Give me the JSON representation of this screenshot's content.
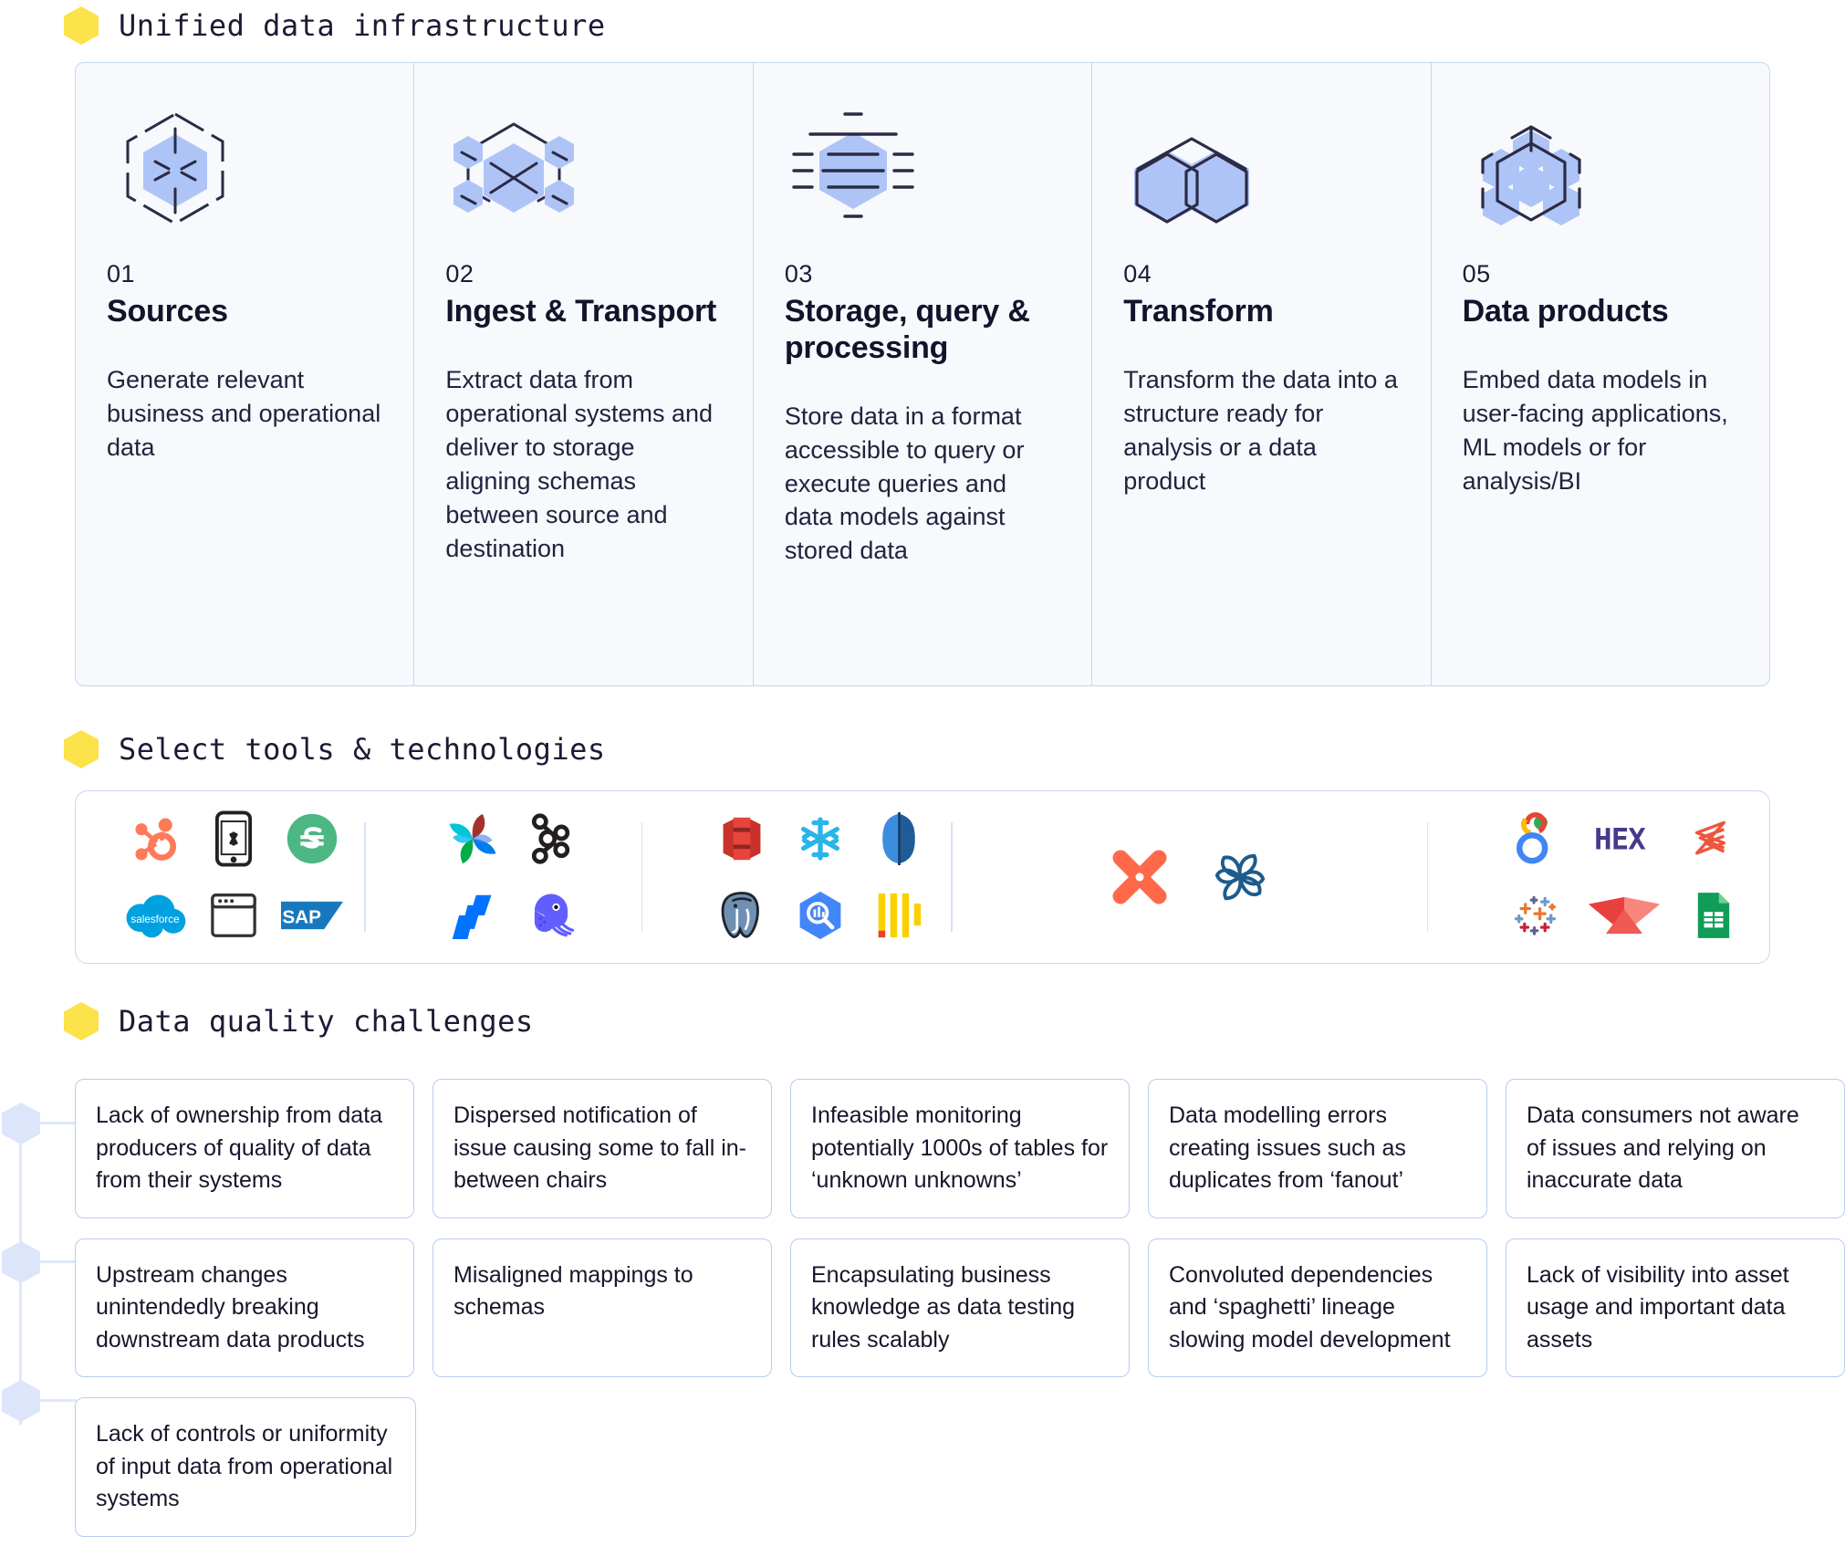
{
  "sections": {
    "infra_title": "Unified data infrastructure",
    "tools_title": "Select tools & technologies",
    "challenges_title": "Data quality challenges"
  },
  "colors": {
    "accent_hex": "#FCE24B",
    "border_blue": "#c7d6f6",
    "panel_bg": "#f7f9fd",
    "icon_fill": "#aec4f7",
    "icon_stroke": "#2b2b45"
  },
  "infrastructure": [
    {
      "number": "01",
      "caption": "Sources",
      "description": "Generate relevant business and operational data",
      "icon": "hexagon-spokes-icon"
    },
    {
      "number": "02",
      "caption": "Ingest & Transport",
      "description": "Extract data from operational systems and deliver to storage aligning schemas between source and destination",
      "icon": "hexagon-crossed-nodes-icon"
    },
    {
      "number": "03",
      "caption": "Storage, query & processing",
      "description": "Store data in a format accessible to query or execute queries and data models against stored data",
      "icon": "hexagon-lines-icon"
    },
    {
      "number": "04",
      "caption": "Transform",
      "description": "Transform the data into a structure ready for analysis or a data product",
      "icon": "double-hexagon-icon"
    },
    {
      "number": "05",
      "caption": "Data products",
      "description": "Embed data models in user-facing applications, ML models or for analysis/BI",
      "icon": "hexagon-cluster-icon"
    }
  ],
  "tool_groups": [
    {
      "stage": "sources",
      "rows": [
        [
          {
            "name": "hubspot-logo",
            "label": "HubSpot"
          },
          {
            "name": "mobile-app-logo",
            "label": "Mobile app"
          },
          {
            "name": "stripe-logo",
            "label": "Stripe"
          }
        ],
        [
          {
            "name": "salesforce-logo",
            "label": "Salesforce"
          },
          {
            "name": "web-app-logo",
            "label": "Web app"
          },
          {
            "name": "sap-logo",
            "label": "SAP"
          }
        ]
      ]
    },
    {
      "stage": "ingest-transport",
      "rows": [
        [
          {
            "name": "apache-airflow-logo",
            "label": "Apache Airflow"
          },
          {
            "name": "apache-kafka-logo",
            "label": "Apache Kafka"
          }
        ],
        [
          {
            "name": "fivetran-logo",
            "label": "Fivetran"
          },
          {
            "name": "airbyte-logo",
            "label": "Airbyte"
          }
        ]
      ]
    },
    {
      "stage": "storage-query-processing",
      "rows": [
        [
          {
            "name": "amazon-s3-logo",
            "label": "Amazon S3"
          },
          {
            "name": "snowflake-logo",
            "label": "Snowflake"
          },
          {
            "name": "amazon-redshift-logo",
            "label": "Amazon Redshift"
          }
        ],
        [
          {
            "name": "postgresql-logo",
            "label": "PostgreSQL"
          },
          {
            "name": "bigquery-logo",
            "label": "BigQuery"
          },
          {
            "name": "clickhouse-logo",
            "label": "ClickHouse"
          }
        ]
      ]
    },
    {
      "stage": "transform",
      "rows": [
        [
          {
            "name": "dbt-logo",
            "label": "dbt"
          },
          {
            "name": "apache-spark-logo",
            "label": "Spark"
          }
        ]
      ]
    },
    {
      "stage": "data-products",
      "rows": [
        [
          {
            "name": "looker-logo",
            "label": "Looker"
          },
          {
            "name": "hex-logo",
            "label": "Hex"
          },
          {
            "name": "databricks-logo",
            "label": "Databricks"
          }
        ],
        [
          {
            "name": "tableau-logo",
            "label": "Tableau"
          },
          {
            "name": "preset-logo",
            "label": "Preset"
          },
          {
            "name": "google-sheets-logo",
            "label": "Google Sheets"
          }
        ]
      ]
    }
  ],
  "challenges": {
    "rows": [
      [
        "Lack of ownership from data producers of quality of data from their systems",
        "Dispersed notification of issue causing some to fall in-between chairs",
        "Infeasible monitoring potentially 1000s of tables for ‘unknown unknowns’",
        "Data modelling errors creating issues such as duplicates from ‘fanout’",
        "Data consumers not aware of issues and relying on inaccurate data"
      ],
      [
        "Upstream changes unintendedly breaking downstream data products",
        "Misaligned mappings to schemas",
        "Encapsulating business knowledge as data testing rules scalably",
        "Convoluted dependencies and ‘spaghetti’ lineage slowing model development",
        "Lack of visibility into asset usage and important data assets"
      ],
      [
        "Lack of controls or uniformity of input data from operational systems",
        "",
        "",
        "",
        ""
      ]
    ]
  }
}
